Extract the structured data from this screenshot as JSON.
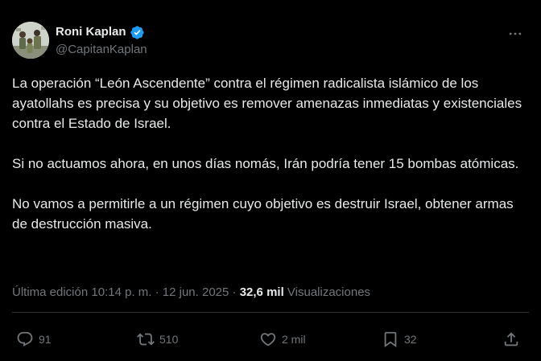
{
  "user": {
    "display_name": "Roni Kaplan",
    "handle": "@CapitanKaplan",
    "verified_color": "#1d9bf0"
  },
  "tweet": {
    "paragraphs": [
      "La operación “León Ascendente” contra el régimen radicalista islámico de los ayatollahs es precisa y su objetivo es remover amenazas inmediatas y existenciales contra el Estado de Israel.",
      "Si no actuamos ahora, en unos días nomás, Irán podría tener 15 bombas atómicas.",
      "No vamos a permitirle a un régimen cuyo objetivo es destruir Israel, obtener armas de destrucción masiva."
    ]
  },
  "meta": {
    "edited_label": "Última edición",
    "time": "10:14 p. m.",
    "sep1": "·",
    "date": "12 jun. 2025",
    "sep2": "·",
    "views_count": "32,6 mil",
    "views_label": "Visualizaciones"
  },
  "actions": {
    "replies": "91",
    "reposts": "510",
    "likes": "2 mil",
    "bookmarks": "32"
  },
  "icons": {
    "more": "more-horizontal-icon",
    "reply": "reply-icon",
    "repost": "repost-icon",
    "like": "heart-icon",
    "bookmark": "bookmark-icon",
    "share": "share-icon",
    "verified": "verified-badge-icon"
  },
  "colors": {
    "background": "#000000",
    "text": "#e7e9ea",
    "muted": "#71767b",
    "divider": "#2f3336",
    "accent": "#1d9bf0"
  }
}
